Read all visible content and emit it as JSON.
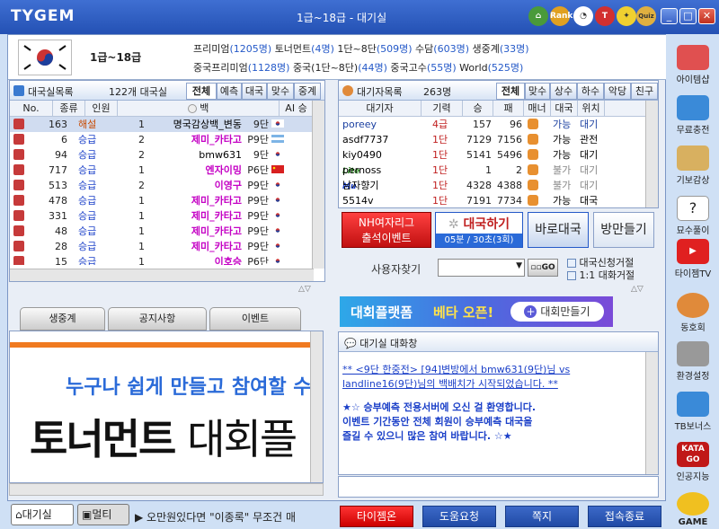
{
  "app": {
    "logo": "TYGEM",
    "window_title": "1급~18급 - 대기실"
  },
  "top_icons": [
    "Rank",
    "Quiz"
  ],
  "header": {
    "rank": "1급~18급",
    "line1": [
      {
        "label": "프리미엄",
        "count": "(1205명)"
      },
      {
        "label": "토너먼트",
        "count": "(4명)"
      },
      {
        "label": "1단~8단",
        "count": "(509명)"
      },
      {
        "label": "수담",
        "count": "(603명)"
      },
      {
        "label": "생중계",
        "count": "(33명)"
      }
    ],
    "line2": [
      {
        "label": "중국프리미엄",
        "count": "(1128명)"
      },
      {
        "label": "중국(1단~8단)",
        "count": "(44명)"
      },
      {
        "label": "중국고수",
        "count": "(55명)"
      },
      {
        "label": "World",
        "count": "(525명)"
      }
    ]
  },
  "rooms": {
    "title": "대국실목록",
    "count": "122개 대국실",
    "tabs": [
      "전체",
      "예측",
      "대국",
      "맞수",
      "중계"
    ],
    "columns": [
      "No.",
      "종류",
      "인원",
      "백",
      "AI 승"
    ],
    "rows": [
      {
        "no": "163",
        "type": "해설",
        "people": "1",
        "white": "명국감상백_변동",
        "rank": "9단",
        "flag": "kr",
        "color": "#000",
        "sel": true
      },
      {
        "no": "6",
        "type": "승급",
        "people": "2",
        "white": "제미_카타고",
        "rank": "P9단",
        "flag": "ar",
        "color": "#c400c4"
      },
      {
        "no": "94",
        "type": "승급",
        "people": "2",
        "white": "bmw631",
        "rank": "9단",
        "flag": "kr",
        "color": "#000"
      },
      {
        "no": "717",
        "type": "승급",
        "people": "1",
        "white": "엔자이밍",
        "rank": "P6단",
        "flag": "cn",
        "color": "#c400c4"
      },
      {
        "no": "513",
        "type": "승급",
        "people": "2",
        "white": "이영구",
        "rank": "P9단",
        "flag": "kr",
        "color": "#c400c4"
      },
      {
        "no": "478",
        "type": "승급",
        "people": "1",
        "white": "제미_카타고",
        "rank": "P9단",
        "flag": "kr",
        "color": "#c400c4"
      },
      {
        "no": "331",
        "type": "승급",
        "people": "1",
        "white": "제미_카타고",
        "rank": "P9단",
        "flag": "kr",
        "color": "#c400c4"
      },
      {
        "no": "48",
        "type": "승급",
        "people": "1",
        "white": "제미_카타고",
        "rank": "P9단",
        "flag": "kr",
        "color": "#c400c4"
      },
      {
        "no": "28",
        "type": "승급",
        "people": "1",
        "white": "제미_카타고",
        "rank": "P9단",
        "flag": "kr",
        "color": "#c400c4"
      },
      {
        "no": "15",
        "type": "승급",
        "people": "1",
        "white": "이호승",
        "rank": "P6단",
        "flag": "kr",
        "color": "#c400c4"
      }
    ]
  },
  "waiting": {
    "title": "대기자목록",
    "count": "263명",
    "tabs": [
      "전체",
      "맞수",
      "상수",
      "하수",
      "악당",
      "친구"
    ],
    "columns": [
      "대기자",
      "기력",
      "승",
      "패",
      "매너",
      "대국",
      "위치"
    ],
    "rows": [
      {
        "name": "poreey",
        "rank": "4급",
        "w": "157",
        "l": "96",
        "avail": "가능",
        "loc": "대기",
        "nc": "#1a3fa0",
        "ac": "#1a3fa0"
      },
      {
        "name": "asdf7737",
        "rank": "1단",
        "w": "7129",
        "l": "7156",
        "avail": "가능",
        "loc": "관전",
        "nc": "#000",
        "ac": "#000"
      },
      {
        "name": "kiy0490",
        "rank": "1단",
        "w": "5141",
        "l": "5496",
        "avail": "가능",
        "loc": "대기",
        "nc": "#000",
        "ac": "#000"
      },
      {
        "name": "pernoss",
        "badge": "Lite",
        "rank": "1단",
        "w": "1",
        "l": "2",
        "avail": "불가",
        "loc": "대기",
        "nc": "#000",
        "ac": "#888"
      },
      {
        "name": "남자향기",
        "badge": "Mu",
        "rank": "1단",
        "w": "4328",
        "l": "4388",
        "avail": "불가",
        "loc": "대기",
        "nc": "#000",
        "ac": "#888"
      },
      {
        "name": "5514v",
        "rank": "1단",
        "w": "7191",
        "l": "7734",
        "avail": "가능",
        "loc": "대국",
        "nc": "#000",
        "ac": "#000"
      }
    ]
  },
  "event_tabs": [
    "생중계",
    "공지사항",
    "이벤트"
  ],
  "banner": {
    "line1": "누구나 쉽게 만들고 참여할 수",
    "line2a": "토너먼트",
    "line2b": "대회플"
  },
  "buttons": {
    "nh": "NH여자리그",
    "nh2": "출석이벤트",
    "match": "대국하기",
    "match_time": "05분 / 30초(3회)",
    "quick": "바로대국",
    "create": "방만들기"
  },
  "user_search": {
    "label": "사용자찾기",
    "go": "GO",
    "opt1": "대국신청거절",
    "opt2": "1:1 대화거절"
  },
  "tournament": {
    "text1": "대회플랫폼",
    "text2": "베타 오픈!",
    "btn": "대회만들기"
  },
  "chat": {
    "title": "대기실 대화창",
    "line1": "** <9단 한중전> [94]변방에서 bmw631(9단)님 vs",
    "line2": "landline16(9단)님의 백배치가 시작되었습니다. **",
    "line3": "★☆ 승부예측 전용서버에 오신 걸 환영합니다.",
    "line4": "이벤트 기간동안 전체 회원이 승부예측 대국을",
    "line5": "즐길 수 있으니 많은 참여 바랍니다. ☆★"
  },
  "bottom": {
    "tab1": "대기실",
    "tab2": "멀티",
    "ticker": "▶ 오만원있다면 \"이종록\" 무조건 매",
    "btns": [
      "타이젬온",
      "도움요청",
      "쪽지",
      "접속종료"
    ]
  },
  "sidebar": [
    "아이템샵",
    "무료충전",
    "기보감상",
    "묘수풀이",
    "타이젬TV",
    "동호회",
    "환경설정",
    "TB보너스",
    "인공지능",
    "GAME"
  ],
  "colors": {
    "title_bar": "#2d5cc2",
    "magenta": "#c400c4",
    "red_btn": "#e02020",
    "blue": "#2459c8"
  }
}
